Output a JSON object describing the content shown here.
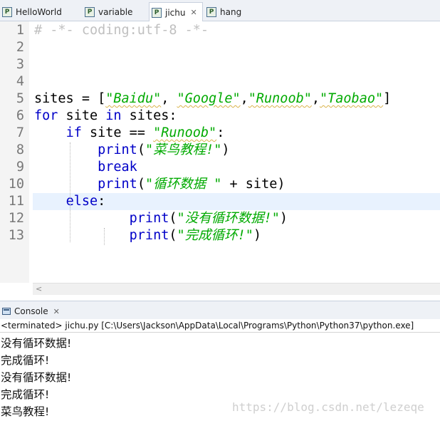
{
  "tabs": [
    {
      "label": "HelloWorld",
      "active": false,
      "closable": false
    },
    {
      "label": "variable",
      "active": false,
      "closable": false
    },
    {
      "label": "jichu",
      "active": true,
      "closable": true
    },
    {
      "label": "hang",
      "active": false,
      "closable": false
    }
  ],
  "tab_icon_letter": "P",
  "close_glyph": "✕",
  "editor": {
    "current_line": 11,
    "lines": [
      {
        "num": "1",
        "tokens": [
          {
            "t": "cm",
            "v": "# -*- coding:utf-8 -*-"
          }
        ]
      },
      {
        "num": "2",
        "tokens": []
      },
      {
        "num": "3",
        "tokens": []
      },
      {
        "num": "4",
        "tokens": []
      },
      {
        "num": "5",
        "tokens": [
          {
            "t": "pl",
            "v": "sites = ["
          },
          {
            "t": "st",
            "v": "\"Baidu\"",
            "sq": true
          },
          {
            "t": "pl",
            "v": ", "
          },
          {
            "t": "st",
            "v": "\"Google\"",
            "sq": true
          },
          {
            "t": "pl",
            "v": ","
          },
          {
            "t": "st",
            "v": "\"Runoob\"",
            "sq": true
          },
          {
            "t": "pl",
            "v": ","
          },
          {
            "t": "st",
            "v": "\"Taobao\"",
            "sq": true
          },
          {
            "t": "pl",
            "v": "]"
          }
        ]
      },
      {
        "num": "6",
        "tokens": [
          {
            "t": "kw",
            "v": "for"
          },
          {
            "t": "pl",
            "v": " site "
          },
          {
            "t": "kw",
            "v": "in"
          },
          {
            "t": "pl",
            "v": " sites:"
          }
        ]
      },
      {
        "num": "7",
        "tokens": [
          {
            "t": "pl",
            "v": "    "
          },
          {
            "t": "kw",
            "v": "if"
          },
          {
            "t": "pl",
            "v": " site == "
          },
          {
            "t": "st",
            "v": "\"Runoob\"",
            "sq": true
          },
          {
            "t": "pl",
            "v": ":"
          }
        ]
      },
      {
        "num": "8",
        "tokens": [
          {
            "t": "pl",
            "v": "        "
          },
          {
            "t": "fn",
            "v": "print"
          },
          {
            "t": "pl",
            "v": "("
          },
          {
            "t": "st",
            "v": "\"菜鸟教程!\""
          },
          {
            "t": "pl",
            "v": ")"
          }
        ]
      },
      {
        "num": "9",
        "tokens": [
          {
            "t": "pl",
            "v": "        "
          },
          {
            "t": "kw",
            "v": "break"
          }
        ]
      },
      {
        "num": "10",
        "tokens": [
          {
            "t": "pl",
            "v": "        "
          },
          {
            "t": "fn",
            "v": "print"
          },
          {
            "t": "pl",
            "v": "("
          },
          {
            "t": "st",
            "v": "\"循环数据 \""
          },
          {
            "t": "pl",
            "v": " + site)"
          }
        ]
      },
      {
        "num": "11",
        "tokens": [
          {
            "t": "pl",
            "v": "    "
          },
          {
            "t": "kw",
            "v": "else"
          },
          {
            "t": "pl",
            "v": ":"
          }
        ]
      },
      {
        "num": "12",
        "tokens": [
          {
            "t": "pl",
            "v": "            "
          },
          {
            "t": "fn",
            "v": "print"
          },
          {
            "t": "pl",
            "v": "("
          },
          {
            "t": "st",
            "v": "\"没有循环数据!\""
          },
          {
            "t": "pl",
            "v": ")"
          }
        ]
      },
      {
        "num": "13",
        "tokens": [
          {
            "t": "pl",
            "v": "            "
          },
          {
            "t": "fn",
            "v": "print"
          },
          {
            "t": "pl",
            "v": "("
          },
          {
            "t": "st",
            "v": "\"完成循环!\""
          },
          {
            "t": "pl",
            "v": ")"
          }
        ]
      }
    ]
  },
  "hscroll_arrow": "<",
  "console": {
    "tab_label": "Console",
    "status": "<terminated> jichu.py [C:\\Users\\Jackson\\AppData\\Local\\Programs\\Python\\Python37\\python.exe]",
    "output": [
      "没有循环数据!",
      "完成循环!",
      "没有循环数据!",
      "完成循环!",
      "菜鸟教程!"
    ]
  },
  "watermark": "https://blog.csdn.net/lezeqe",
  "colors": {
    "keyword": "#0000c8",
    "string": "#00aa00",
    "comment": "#c0c0c0",
    "line_numbers": "#787878",
    "current_line": "#e8f2fe"
  }
}
